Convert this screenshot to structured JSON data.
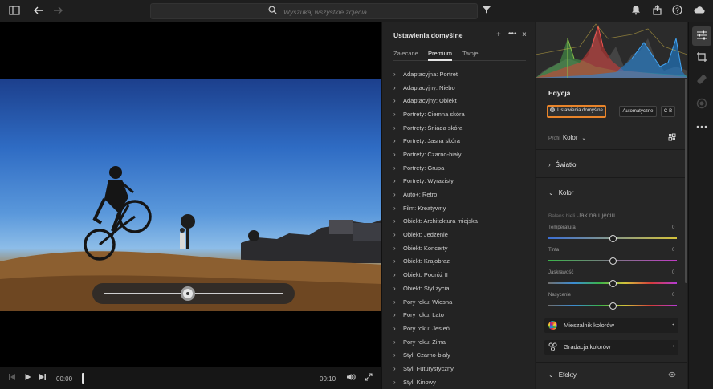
{
  "topbar": {
    "search_placeholder": "Wyszukaj wszystkie zdjęcia",
    "icons": [
      "sidebar-icon",
      "back-arrow-icon",
      "forward-arrow-icon",
      "search-icon",
      "filter-icon",
      "bell-icon",
      "share-icon",
      "help-icon",
      "cloud-icon"
    ]
  },
  "video": {
    "scrub_position": 0.47,
    "time_current": "00:00",
    "time_total": "00:10"
  },
  "presets": {
    "title": "Ustawienia domyślne",
    "tabs": [
      {
        "label": "Zalecane",
        "active": false
      },
      {
        "label": "Premium",
        "active": true
      },
      {
        "label": "Twoje",
        "active": false
      }
    ],
    "items": [
      "Adaptacyjna: Portret",
      "Adaptacyjny: Niebo",
      "Adaptacyjny: Obiekt",
      "Portrety: Ciemna skóra",
      "Portrety: Śniada skóra",
      "Portrety: Jasna skóra",
      "Portrety: Czarno-biały",
      "Portrety: Grupa",
      "Portrety: Wyrazisty",
      "Auto+: Retro",
      "Film: Kreatywny",
      "Obiekt: Architektura miejska",
      "Obiekt: Jedzenie",
      "Obiekt: Koncerty",
      "Obiekt: Krajobraz",
      "Obiekt: Podróż II",
      "Obiekt: Styl życia",
      "Pory roku: Wiosna",
      "Pory roku: Lato",
      "Pory roku: Jesień",
      "Pory roku: Zima",
      "Styl: Czarno-biały",
      "Styl: Futurystyczny",
      "Styl: Kinowy"
    ]
  },
  "edit": {
    "title": "Edycja",
    "btn_presets": "Ustawienia domyślne",
    "btn_auto": "Automatyczne",
    "btn_bw": "C-B",
    "profile_label": "Profil",
    "profile_value": "Kolor",
    "section_light": "Światło",
    "section_color": "Kolor",
    "wb_label": "Balans bieli",
    "wb_value": "Jak na ujęciu",
    "sliders": [
      {
        "label": "Temperatura",
        "value": "0",
        "level": 0.5
      },
      {
        "label": "Tinta",
        "value": "0",
        "level": 0.5
      },
      {
        "label": "Jaskrawość",
        "value": "0",
        "level": 0.5
      },
      {
        "label": "Nasycenie",
        "value": "0",
        "level": 0.5
      }
    ],
    "mixer_label": "Mieszalnik kolorów",
    "grading_label": "Gradacja kolorów",
    "section_effects": "Efekty"
  },
  "colors": {
    "accent_orange": "#e8842a"
  }
}
